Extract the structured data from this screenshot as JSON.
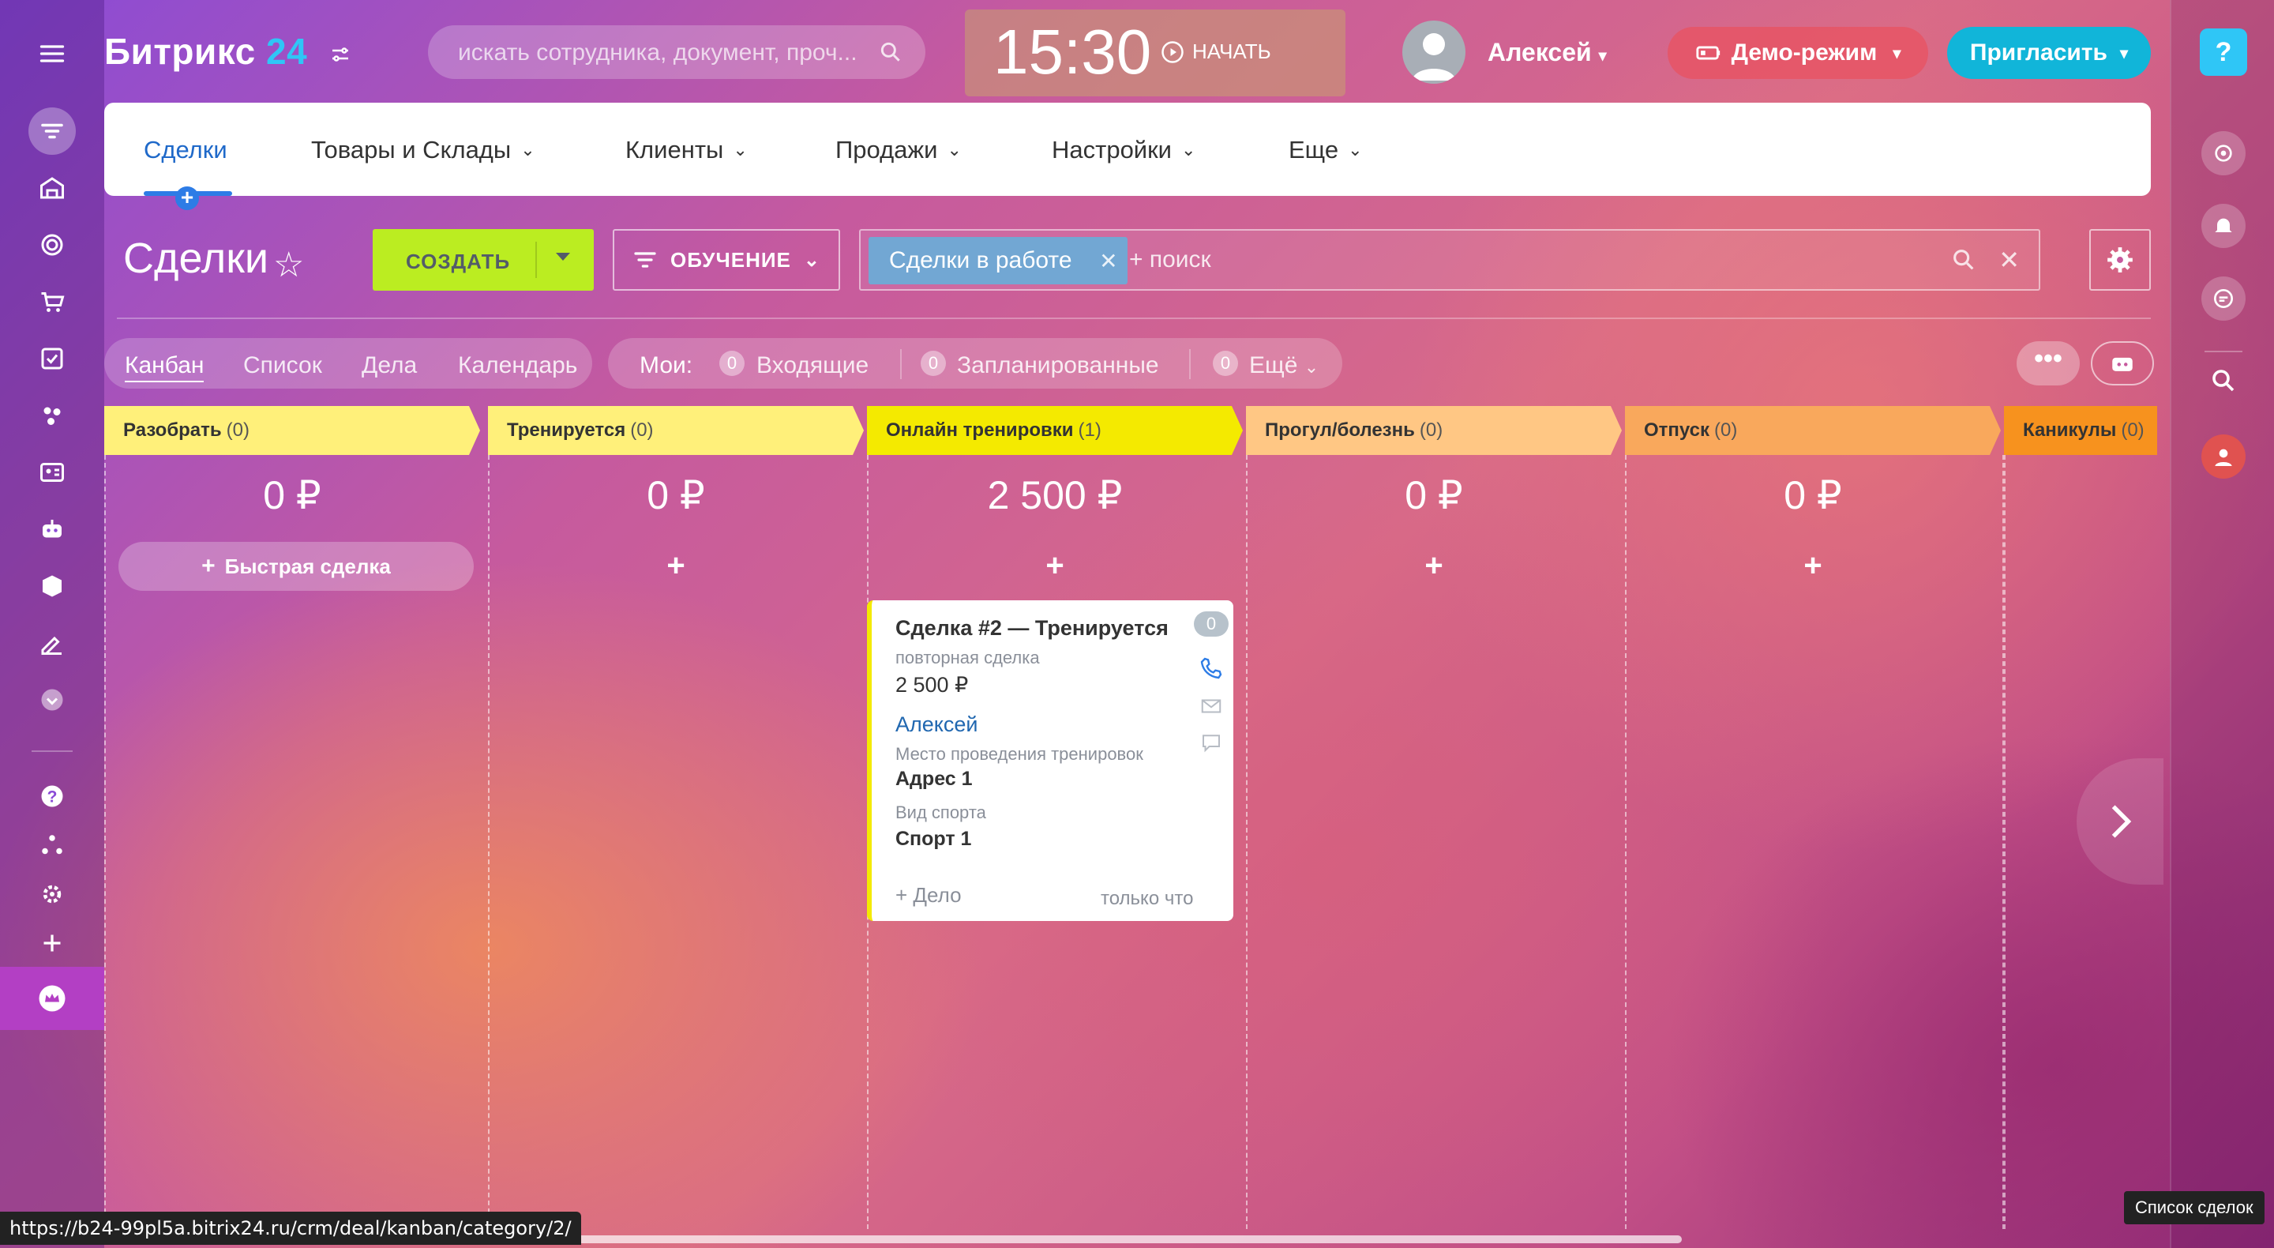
{
  "brand": {
    "name": "Битрикс",
    "num": "24"
  },
  "search": {
    "placeholder": "искать сотрудника, документ, проч..."
  },
  "clock": {
    "time": "15:30",
    "start_label": "НАЧАТЬ"
  },
  "user": {
    "name": "Алексей"
  },
  "demo_label": "Демо-режим",
  "invite_label": "Пригласить",
  "help_label": "?",
  "menu": [
    {
      "label": "Сделки",
      "active": true
    },
    {
      "label": "Товары и Склады"
    },
    {
      "label": "Клиенты"
    },
    {
      "label": "Продажи"
    },
    {
      "label": "Настройки"
    },
    {
      "label": "Еще"
    }
  ],
  "toolbar": {
    "title": "Сделки",
    "create_label": "СОЗДАТЬ",
    "training_label": "ОБУЧЕНИЕ",
    "filter_tag": "Сделки в работе",
    "filter_placeholder": "+ поиск"
  },
  "views": [
    "Канбан",
    "Список",
    "Дела",
    "Календарь"
  ],
  "counters": {
    "label": "Мои:",
    "items": [
      {
        "count": "0",
        "label": "Входящие"
      },
      {
        "count": "0",
        "label": "Запланированные"
      },
      {
        "count": "0",
        "label": "Ещё"
      }
    ]
  },
  "columns": [
    {
      "name": "Разобрать",
      "count": "(0)",
      "sum": "0 ₽",
      "color": "#fff07a"
    },
    {
      "name": "Тренируется",
      "count": "(0)",
      "sum": "0 ₽",
      "color": "#fff07a"
    },
    {
      "name": "Онлайн тренировки",
      "count": "(1)",
      "sum": "2 500 ₽",
      "color": "#f4ea00"
    },
    {
      "name": "Прогул/болезнь",
      "count": "(0)",
      "sum": "0 ₽",
      "color": "#ffc784"
    },
    {
      "name": "Отпуск",
      "count": "(0)",
      "sum": "0 ₽",
      "color": "#f9a85c"
    },
    {
      "name": "Каникулы",
      "count": "(0)",
      "sum": "",
      "color": "#f7921e"
    }
  ],
  "quick_deal_label": "Быстрая сделка",
  "add_symbol": "+",
  "deal": {
    "title": "Сделка #2 — Тренируется",
    "subtitle": "повторная сделка",
    "amount": "2 500 ₽",
    "contact": "Алексей",
    "field1_label": "Место проведения тренировок",
    "field1_value": "Адрес 1",
    "field2_label": "Вид спорта",
    "field2_value": "Спорт 1",
    "activity_label": "+ Дело",
    "time": "только что",
    "badge": "0"
  },
  "status_url": "https://b24-99pl5a.bitrix24.ru/crm/deal/kanban/category/2/",
  "tooltip": "Список сделок"
}
